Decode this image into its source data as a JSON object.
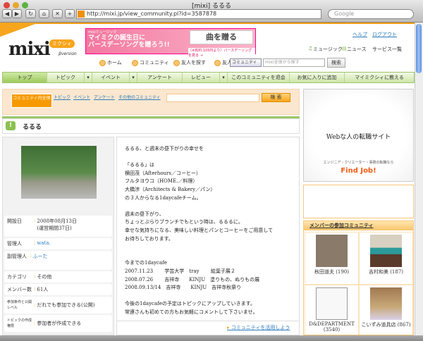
{
  "browser": {
    "window_title": "[mixi] るるる",
    "url": "http://mixi.jp/view_community.pl?id=3587878",
    "search_placeholder": "Google",
    "buttons": [
      "◀",
      "▶",
      "↻",
      "⌂",
      "✕",
      "+"
    ]
  },
  "header": {
    "logo": "mixi",
    "logo_badge": "ミクシィ",
    "logo_version": "βversion",
    "banner": {
      "label": "mixiミュージック",
      "headline": "マイミクの誕生日に\nバースデーソングを贈ろう!!",
      "gift_button": "曲を贈る",
      "sub": "（※有料:105円より）バースデーソングを見る →"
    },
    "links": {
      "help": "ヘルプ",
      "logout": "ログアウト"
    },
    "services": [
      "ミュージック",
      "ニュース",
      "サービス一覧"
    ],
    "nav": [
      "ホーム",
      "コミュニティ",
      "友人を探す",
      "友人を招待"
    ],
    "search": {
      "scope": "コミュニティ",
      "placeholder": "mixi全体から探す",
      "button": "検索"
    }
  },
  "tabs": [
    "トップ",
    "トピック",
    "▾",
    "イベント",
    "▾",
    "アンケート",
    "レビュー",
    "▾",
    "このコミュニティを退会",
    "お気に入りに追加",
    "マイミクシィに教える"
  ],
  "community_search": {
    "active": "コミュニティ内全体",
    "links": [
      "トピック",
      "イベント",
      "アンケート",
      "その他のコミュニティ"
    ],
    "button": "検 索"
  },
  "community": {
    "title": "るるる",
    "info": [
      {
        "key": "開設日",
        "value": "2008年08月13日\n(運営期間37日)"
      },
      {
        "key": "管理人",
        "value": "wata.",
        "link": true
      },
      {
        "key": "副管理人",
        "value": "ふーた",
        "link": true
      },
      {
        "key": "カテゴリ",
        "value": "その他"
      },
      {
        "key": "メンバー数",
        "value": "61人"
      },
      {
        "key": "参加条件と公開レベル",
        "value": "だれでも参加できる(公開)",
        "small": true
      },
      {
        "key": "トピックの作成権限",
        "value": "参加者が作成できる",
        "small": true
      }
    ],
    "description": "るるる、と週末の昼下がりの幸せを\n\n「るるる」は\n横田茂（Afterhours／コーヒー）\nフルタヨウコ（HOME.／料理）\n大橋渉（Architects & Bakery／パン）\nの３人からなる1daycafeチーム。\n\n週末の昼下がり、\nちょっとぶらりブランチでもという時は、るるるに。\n幸せな気持ちになる、美味しい料理とパンとコーヒーをご用意して\nお待ちしております。\n\n\n今までの1daycafe\n2007.11.23　　 学芸大学　tray　　 絵葉子展２\n2008.07.26　　 吉祥寺　　KINJU　塗りもの、ぬりもの展\n2008.09.13/14　吉祥寺　　KINJU　吉祥寺秋祭り\n\n今後の1daycafeの予定はトピックにアップしていきます。\n常連さんも初めての方もお気軽にコメントして下さいませ。",
    "use_link": "コミュニティを活用しよう"
  },
  "ad": {
    "headline": "Webな人の転職サイト",
    "sub": "エンジニア・クリエーター・事務の転職なら",
    "brand": "Find Job!"
  },
  "member_communities": {
    "title": "メンバーの参加コミュニティ",
    "items": [
      {
        "name": "秋田道夫 (190)",
        "color": "#8a7a6a"
      },
      {
        "name": "吉村和美 (187)",
        "color": "#2a9a9a"
      },
      {
        "name": "D&DEPARTMENT (3540)",
        "color": "#f4f4f4"
      },
      {
        "name": "こいずみ道具店 (867)",
        "color": "#a07850"
      }
    ]
  }
}
